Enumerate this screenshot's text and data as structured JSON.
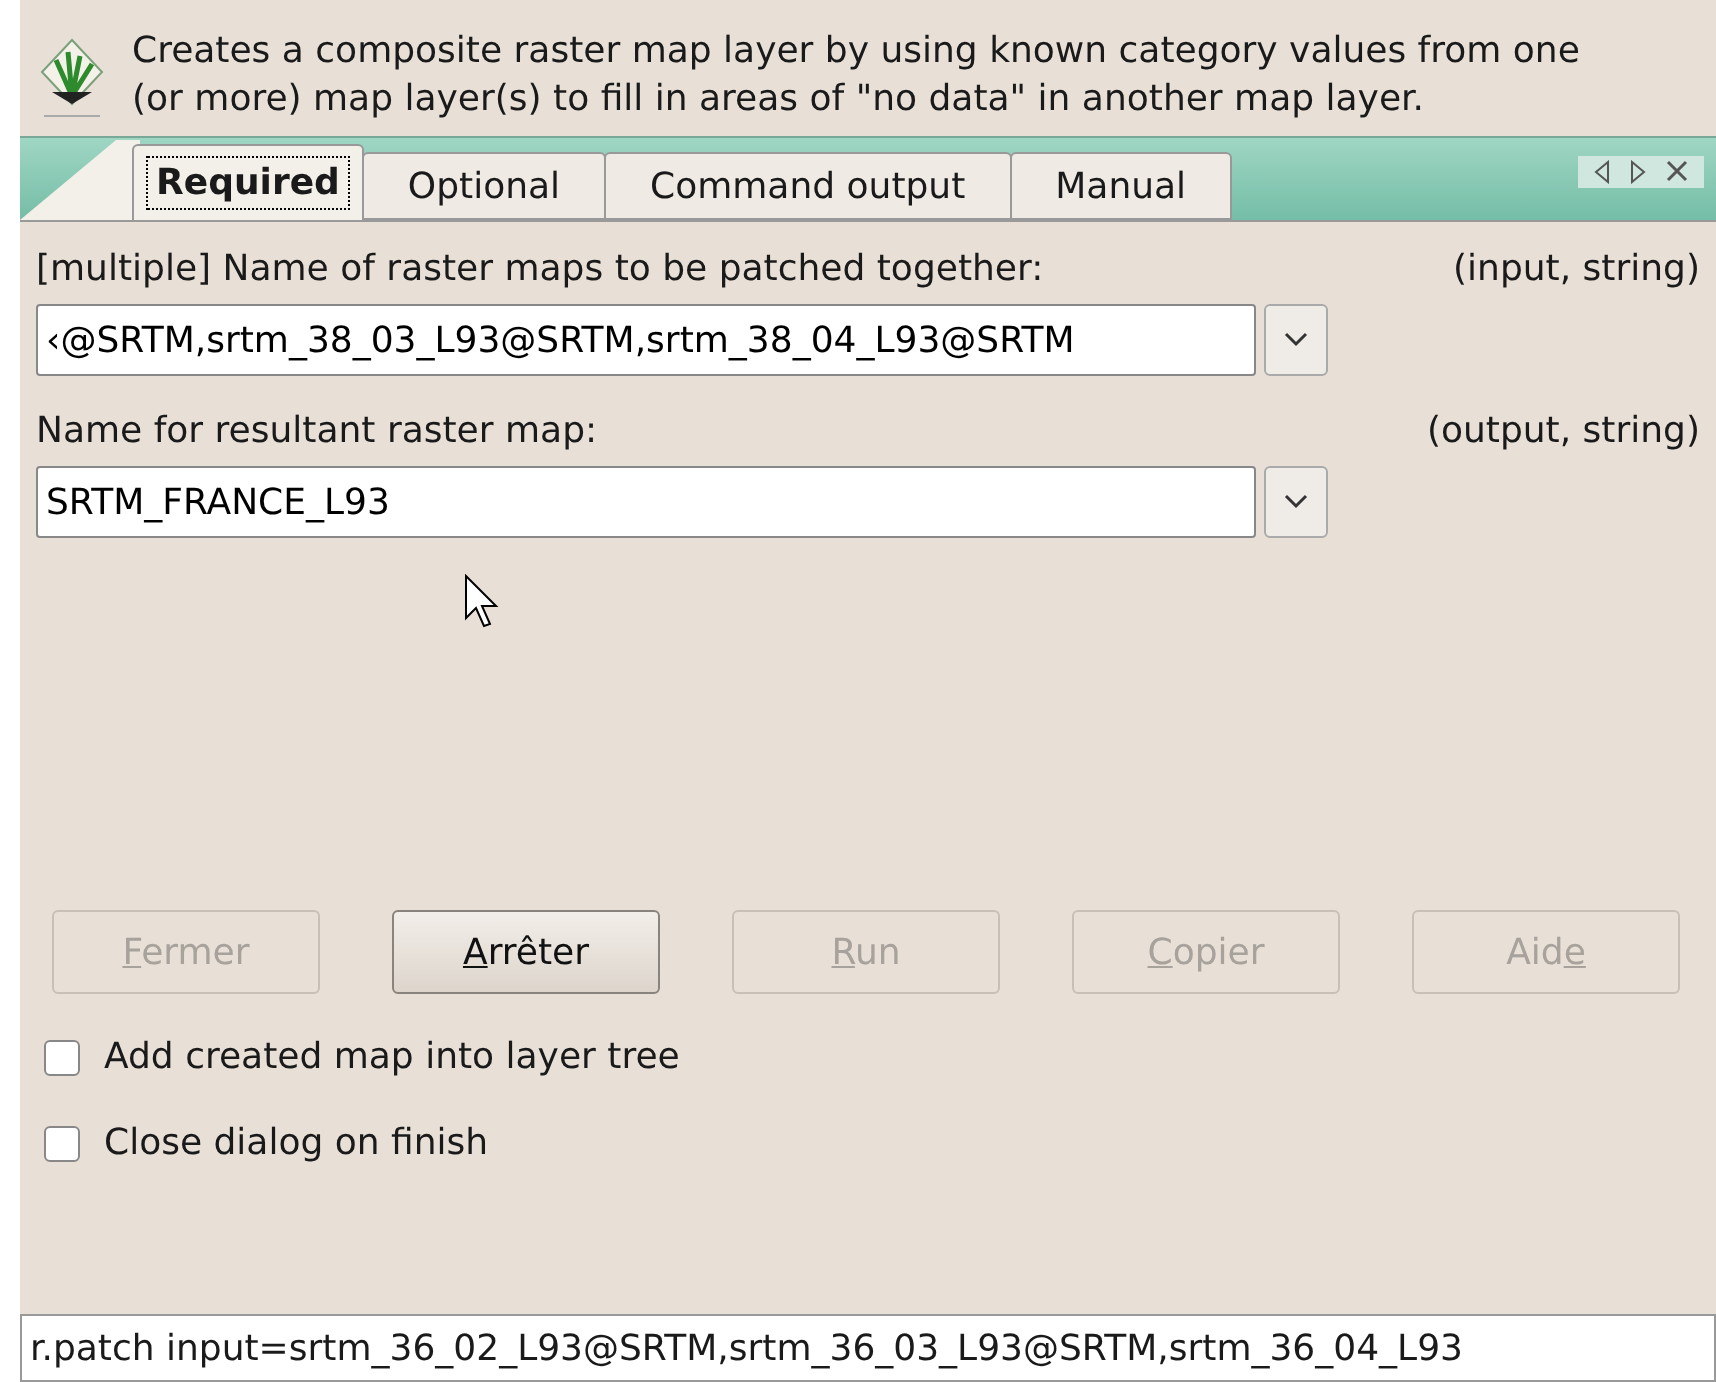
{
  "description": "Creates a composite raster map layer by using known category values from one (or more) map layer(s) to fill in areas of \"no data\" in another map layer.",
  "tabs": [
    {
      "label": "Required",
      "selected": true
    },
    {
      "label": "Optional",
      "selected": false
    },
    {
      "label": "Command output",
      "selected": false
    },
    {
      "label": "Manual",
      "selected": false
    }
  ],
  "fields": [
    {
      "label": "[multiple] Name of raster maps to be patched together:",
      "type_hint": "(input, string)",
      "value": "‹@SRTM,srtm_38_03_L93@SRTM,srtm_38_04_L93@SRTM"
    },
    {
      "label": "Name for resultant raster map:",
      "type_hint": "(output, string)",
      "value": "SRTM_FRANCE_L93"
    }
  ],
  "buttons": [
    {
      "mnemonic": "F",
      "after": "ermer",
      "disabled": true
    },
    {
      "mnemonic": "A",
      "after": "rrêter",
      "disabled": false
    },
    {
      "mnemonic": "R",
      "after": "un",
      "disabled": true
    },
    {
      "mnemonic": "C",
      "after": "opier",
      "disabled": true
    },
    {
      "before": "Aid",
      "mnemonic": "e",
      "disabled": true
    }
  ],
  "options": [
    {
      "label": "Add created map into layer tree",
      "checked": false
    },
    {
      "label": "Close dialog on finish",
      "checked": false
    }
  ],
  "command": "r.patch input=srtm_36_02_L93@SRTM,srtm_36_03_L93@SRTM,srtm_36_04_L93"
}
